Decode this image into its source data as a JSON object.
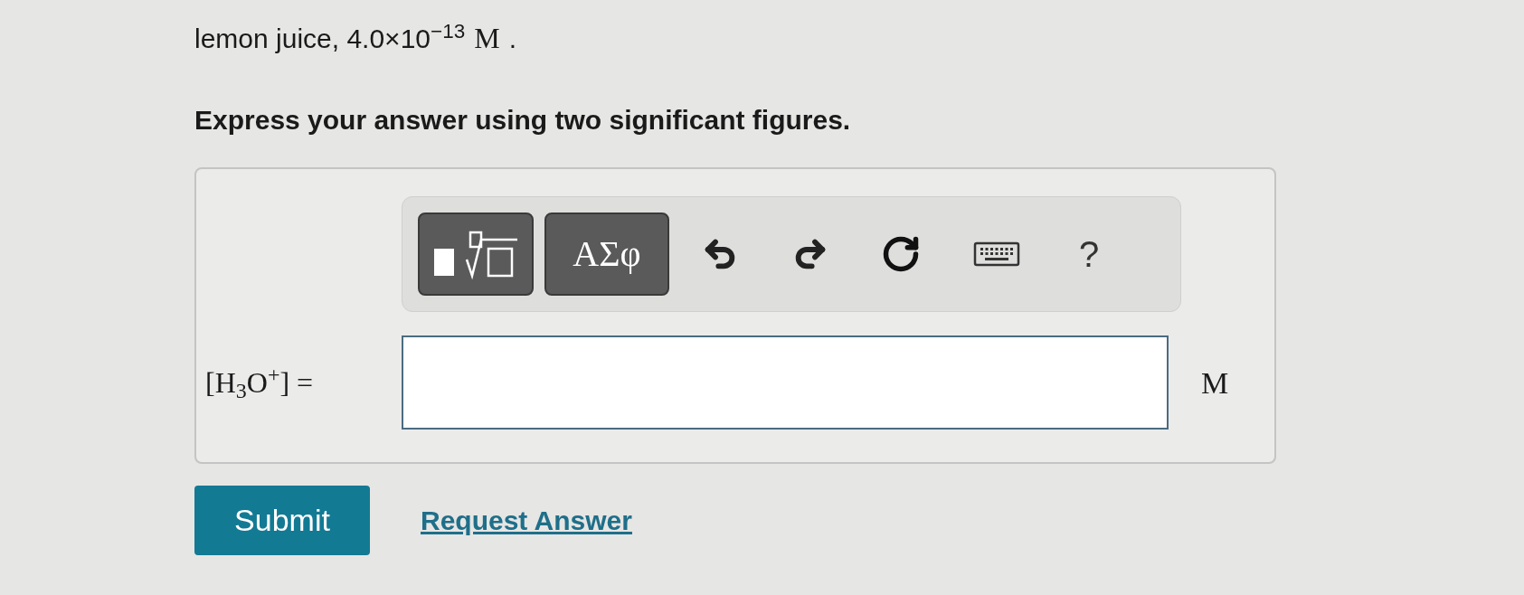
{
  "question": {
    "text": "lemon juice, 4.0×10$^{−13}$",
    "unit": "M",
    "end": "."
  },
  "instruction": "Express your answer using two significant figures.",
  "toolbar": {
    "buttons": [
      {
        "kind": "templates"
      },
      {
        "kind": "symbols",
        "label": "ΑΣφ"
      },
      {
        "kind": "undo"
      },
      {
        "kind": "redo"
      },
      {
        "kind": "reset"
      },
      {
        "kind": "keyboard"
      },
      {
        "kind": "help",
        "label": "?"
      }
    ]
  },
  "answer": {
    "label": "[H$_{3}$O$^{+}$] =",
    "unit": "M"
  },
  "actions": {
    "submit": "Submit",
    "request": "Request Answer"
  }
}
